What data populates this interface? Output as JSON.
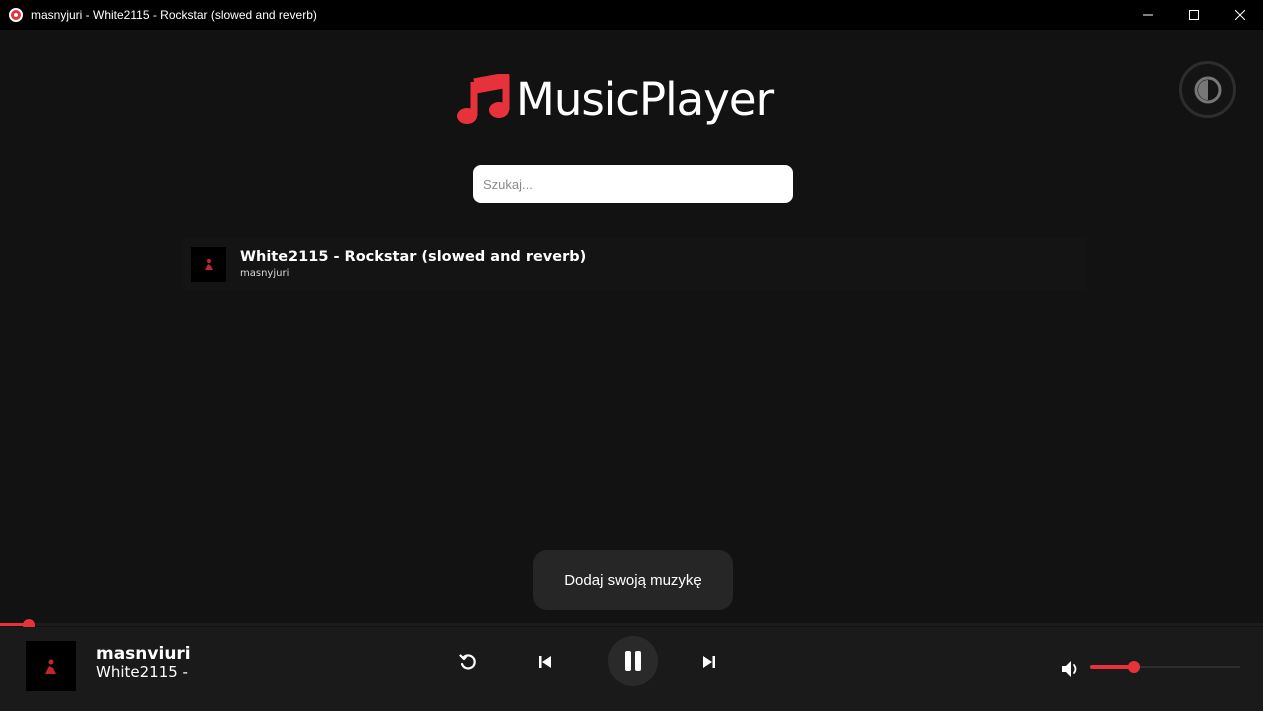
{
  "window": {
    "title": "masnyjuri - White2115 - Rockstar (slowed and reverb)",
    "icon": "app-music-icon",
    "controls": [
      "minimize-icon",
      "maximize-icon",
      "close-icon"
    ]
  },
  "header": {
    "logo_icon": "music-note-icon",
    "logo_text": "MusicPlayer",
    "theme_toggle_icon": "contrast-icon"
  },
  "search": {
    "placeholder": "Szukaj...",
    "value": ""
  },
  "tracks": [
    {
      "title": "White2115 - Rockstar (slowed and reverb)",
      "artist": "masnyjuri"
    }
  ],
  "add_music_label": "Dodaj swoją muzykę",
  "player": {
    "artist": "masnviuri",
    "title": "White2115 -",
    "progress": 0.023,
    "volume": 0.29,
    "playing": true
  },
  "colors": {
    "accent": "#e8323b",
    "background": "#121212",
    "player_bar": "#1a1a1a"
  }
}
